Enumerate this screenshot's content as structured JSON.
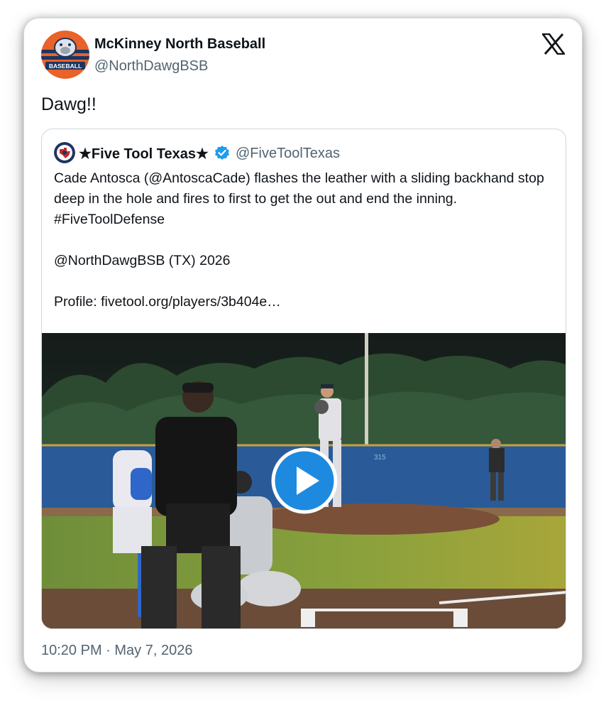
{
  "author": {
    "name": "McKinney North Baseball",
    "handle": "@NorthDawgBSB",
    "avatar_text": "BASEBALL"
  },
  "tweet": {
    "text": "Dawg!!",
    "timestamp": "10:20 PM · May 7, 2026"
  },
  "quoted": {
    "name": "★Five Tool Texas★",
    "handle": "@FiveToolTexas",
    "verified": true,
    "body_line1": "Cade Antosca (@AntoscaCade) flashes the leather with a sliding backhand stop deep in the hole and fires to first to get the out and end the inning. #FiveToolDefense",
    "body_line2": "@NorthDawgBSB (TX) 2026",
    "body_line3": "Profile: fivetool.org/players/3b404e…"
  },
  "media": {
    "fence_number": "315"
  },
  "colors": {
    "verified_blue": "#1d9bf0",
    "play_blue": "#1d8ae0",
    "avatar_orange": "#e8622a",
    "avatar_navy": "#1e3560"
  }
}
